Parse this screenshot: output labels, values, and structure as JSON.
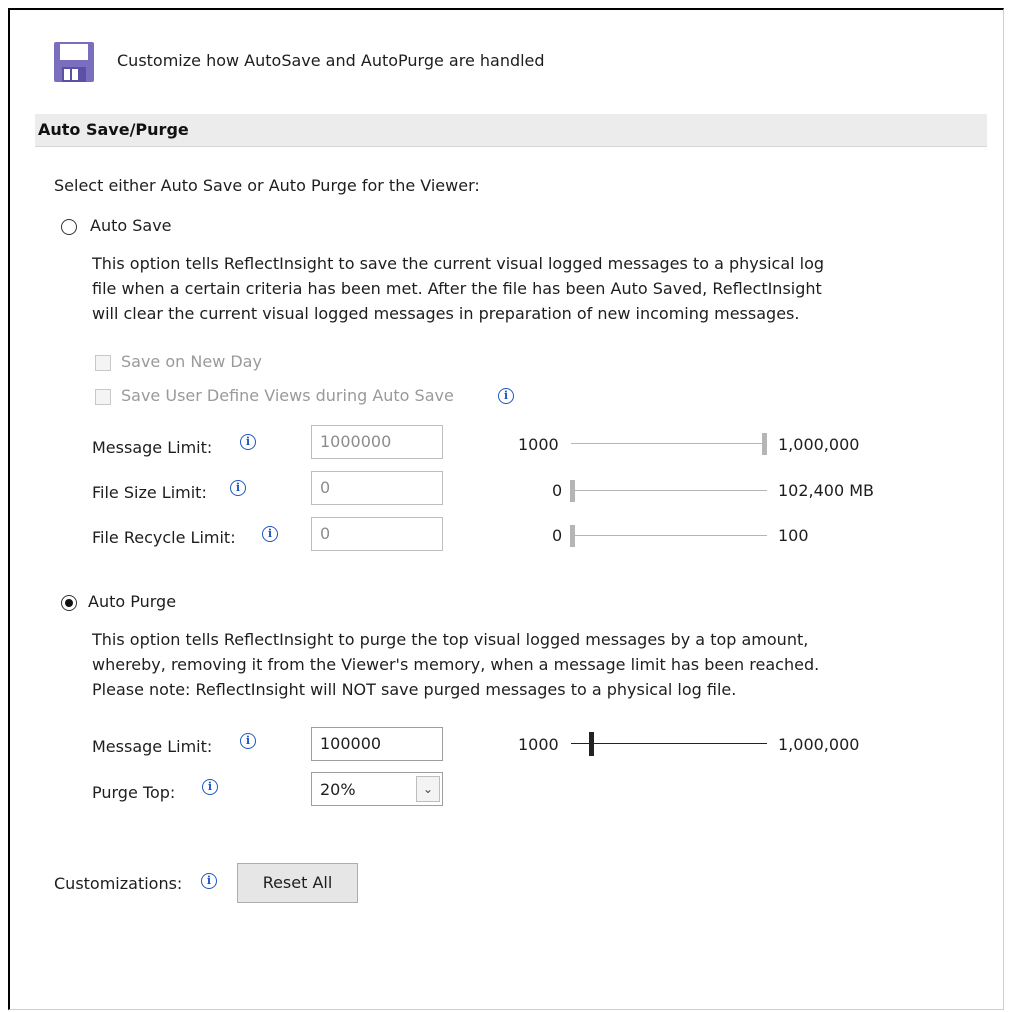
{
  "header": {
    "icon": "floppy-disk-icon",
    "text": "Customize how AutoSave and AutoPurge are handled"
  },
  "section": {
    "title": "Auto Save/Purge"
  },
  "intro": "Select either Auto Save or Auto Purge for the Viewer:",
  "auto_save": {
    "label": "Auto Save",
    "selected": false,
    "description": [
      "This option tells ReflectInsight to save the current visual logged messages to a physical log",
      "file when a certain criteria has been met. After the file has been Auto Saved, ReflectInsight",
      "will clear the current visual logged messages in preparation of new incoming messages."
    ],
    "save_on_new_day": {
      "label": "Save on New Day",
      "checked": false
    },
    "save_user_views": {
      "label": "Save User Define Views during Auto Save",
      "checked": false
    },
    "message_limit": {
      "label": "Message Limit:",
      "value": "1000000",
      "slider_min": "1000",
      "slider_max": "1,000,000",
      "level": 1.0
    },
    "file_size_limit": {
      "label": "File Size Limit:",
      "value": "0",
      "slider_min": "0",
      "slider_max": "102,400 MB",
      "level": 0.0
    },
    "file_recycle_limit": {
      "label": "File Recycle Limit:",
      "value": "0",
      "slider_min": "0",
      "slider_max": "100",
      "level": 0.0
    }
  },
  "auto_purge": {
    "label": "Auto Purge",
    "selected": true,
    "description": [
      "This option tells ReflectInsight to purge the top visual logged messages by a top amount,",
      "whereby, removing it from the Viewer's memory, when a message limit has been reached.",
      "Please note: ReflectInsight will NOT save purged messages to a physical log file."
    ],
    "message_limit": {
      "label": "Message Limit:",
      "value": "100000",
      "slider_min": "1000",
      "slider_max": "1,000,000",
      "level": 0.1
    },
    "purge_top": {
      "label": "Purge Top:",
      "value": "20%"
    }
  },
  "customizations": {
    "label": "Customizations:",
    "reset_button": "Reset All"
  },
  "icons": {
    "info": "i",
    "dropdown": "⌄"
  },
  "colors": {
    "info_icon": "#1f56c0",
    "section_bar": "#ececec",
    "disabled_text": "#9a9a9a"
  }
}
